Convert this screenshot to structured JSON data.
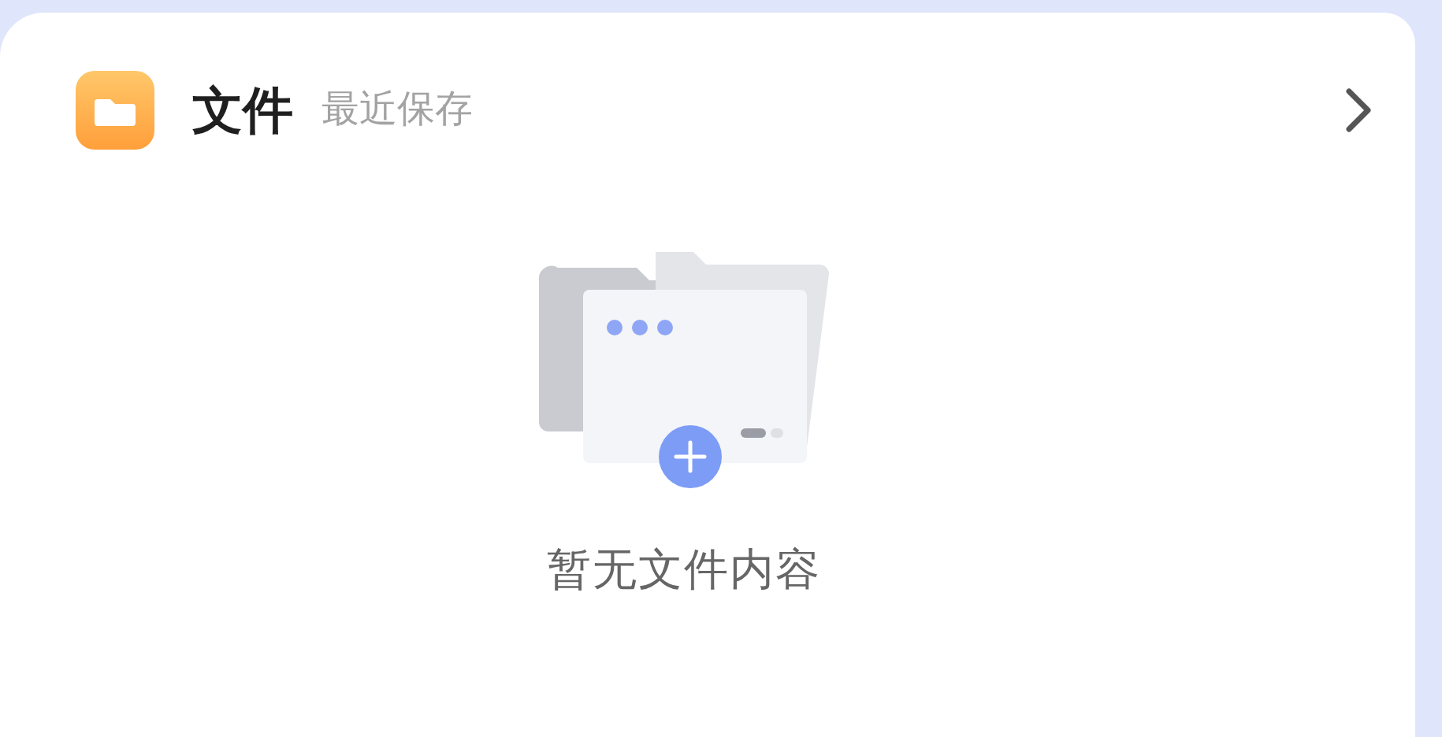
{
  "card": {
    "title": "文件",
    "subtitle": "最近保存"
  },
  "empty_state": {
    "message": "暂无文件内容"
  }
}
